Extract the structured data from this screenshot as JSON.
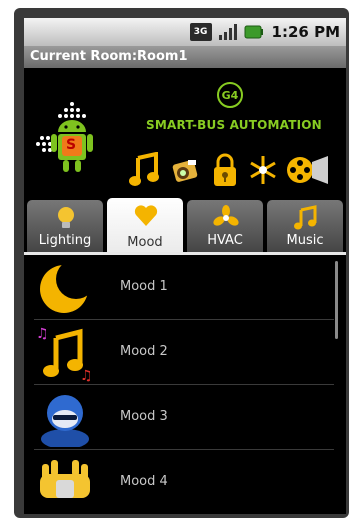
{
  "status_bar": {
    "network_badge": "3G",
    "time": "1:26 PM",
    "icons": [
      "3g-icon",
      "signal-icon",
      "battery-icon"
    ]
  },
  "title_bar": {
    "title": "Current Room:Room1"
  },
  "header": {
    "badge": "G4",
    "brand": "SMART-BUS AUTOMATION",
    "android_badge_letter": "S",
    "icons": [
      "music-note-icon",
      "camera-icon",
      "lock-icon",
      "snowflake-icon",
      "film-reel-icon"
    ]
  },
  "tabs": [
    {
      "label": "Lighting",
      "icon": "light-bulb-icon",
      "active": false
    },
    {
      "label": "Mood",
      "icon": "heart-icon",
      "active": true
    },
    {
      "label": "HVAC",
      "icon": "fan-icon",
      "active": false
    },
    {
      "label": "Music",
      "icon": "music-note-icon",
      "active": false
    }
  ],
  "moods": [
    {
      "label": "Mood 1",
      "icon": "moon-icon"
    },
    {
      "label": "Mood 2",
      "icon": "music-notes-icon"
    },
    {
      "label": "Mood 3",
      "icon": "avatar-headset-icon"
    },
    {
      "label": "Mood 4",
      "icon": "hands-icon"
    }
  ],
  "colors": {
    "brand_green": "#88cc22",
    "icon_gold": "#f4b400",
    "tab_active": "#ffffff",
    "tab_inactive": "#5a5a5a"
  }
}
